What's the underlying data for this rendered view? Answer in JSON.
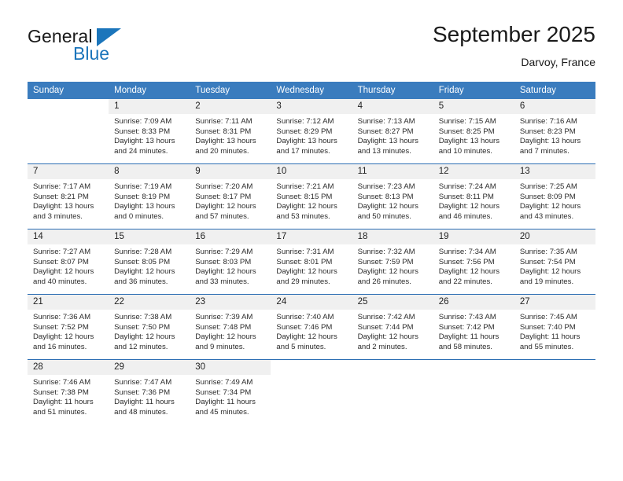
{
  "brand": {
    "name_part1": "General",
    "name_part2": "Blue",
    "flag_icon": "triangle-flag-icon",
    "accent_color": "#1b75bb"
  },
  "header": {
    "month_title": "September 2025",
    "location": "Darvoy, France"
  },
  "colors": {
    "header_blue": "#3a7cbe",
    "week_divider_blue": "#2a6db3",
    "daynum_band": "#f0f0f0",
    "text": "#2b2b2b"
  },
  "calendar": {
    "weekday_headers": [
      "Sunday",
      "Monday",
      "Tuesday",
      "Wednesday",
      "Thursday",
      "Friday",
      "Saturday"
    ],
    "weeks": [
      [
        {
          "day": "",
          "lines": []
        },
        {
          "day": "1",
          "lines": [
            "Sunrise: 7:09 AM",
            "Sunset: 8:33 PM",
            "Daylight: 13 hours",
            "and 24 minutes."
          ]
        },
        {
          "day": "2",
          "lines": [
            "Sunrise: 7:11 AM",
            "Sunset: 8:31 PM",
            "Daylight: 13 hours",
            "and 20 minutes."
          ]
        },
        {
          "day": "3",
          "lines": [
            "Sunrise: 7:12 AM",
            "Sunset: 8:29 PM",
            "Daylight: 13 hours",
            "and 17 minutes."
          ]
        },
        {
          "day": "4",
          "lines": [
            "Sunrise: 7:13 AM",
            "Sunset: 8:27 PM",
            "Daylight: 13 hours",
            "and 13 minutes."
          ]
        },
        {
          "day": "5",
          "lines": [
            "Sunrise: 7:15 AM",
            "Sunset: 8:25 PM",
            "Daylight: 13 hours",
            "and 10 minutes."
          ]
        },
        {
          "day": "6",
          "lines": [
            "Sunrise: 7:16 AM",
            "Sunset: 8:23 PM",
            "Daylight: 13 hours",
            "and 7 minutes."
          ]
        }
      ],
      [
        {
          "day": "7",
          "lines": [
            "Sunrise: 7:17 AM",
            "Sunset: 8:21 PM",
            "Daylight: 13 hours",
            "and 3 minutes."
          ]
        },
        {
          "day": "8",
          "lines": [
            "Sunrise: 7:19 AM",
            "Sunset: 8:19 PM",
            "Daylight: 13 hours",
            "and 0 minutes."
          ]
        },
        {
          "day": "9",
          "lines": [
            "Sunrise: 7:20 AM",
            "Sunset: 8:17 PM",
            "Daylight: 12 hours",
            "and 57 minutes."
          ]
        },
        {
          "day": "10",
          "lines": [
            "Sunrise: 7:21 AM",
            "Sunset: 8:15 PM",
            "Daylight: 12 hours",
            "and 53 minutes."
          ]
        },
        {
          "day": "11",
          "lines": [
            "Sunrise: 7:23 AM",
            "Sunset: 8:13 PM",
            "Daylight: 12 hours",
            "and 50 minutes."
          ]
        },
        {
          "day": "12",
          "lines": [
            "Sunrise: 7:24 AM",
            "Sunset: 8:11 PM",
            "Daylight: 12 hours",
            "and 46 minutes."
          ]
        },
        {
          "day": "13",
          "lines": [
            "Sunrise: 7:25 AM",
            "Sunset: 8:09 PM",
            "Daylight: 12 hours",
            "and 43 minutes."
          ]
        }
      ],
      [
        {
          "day": "14",
          "lines": [
            "Sunrise: 7:27 AM",
            "Sunset: 8:07 PM",
            "Daylight: 12 hours",
            "and 40 minutes."
          ]
        },
        {
          "day": "15",
          "lines": [
            "Sunrise: 7:28 AM",
            "Sunset: 8:05 PM",
            "Daylight: 12 hours",
            "and 36 minutes."
          ]
        },
        {
          "day": "16",
          "lines": [
            "Sunrise: 7:29 AM",
            "Sunset: 8:03 PM",
            "Daylight: 12 hours",
            "and 33 minutes."
          ]
        },
        {
          "day": "17",
          "lines": [
            "Sunrise: 7:31 AM",
            "Sunset: 8:01 PM",
            "Daylight: 12 hours",
            "and 29 minutes."
          ]
        },
        {
          "day": "18",
          "lines": [
            "Sunrise: 7:32 AM",
            "Sunset: 7:59 PM",
            "Daylight: 12 hours",
            "and 26 minutes."
          ]
        },
        {
          "day": "19",
          "lines": [
            "Sunrise: 7:34 AM",
            "Sunset: 7:56 PM",
            "Daylight: 12 hours",
            "and 22 minutes."
          ]
        },
        {
          "day": "20",
          "lines": [
            "Sunrise: 7:35 AM",
            "Sunset: 7:54 PM",
            "Daylight: 12 hours",
            "and 19 minutes."
          ]
        }
      ],
      [
        {
          "day": "21",
          "lines": [
            "Sunrise: 7:36 AM",
            "Sunset: 7:52 PM",
            "Daylight: 12 hours",
            "and 16 minutes."
          ]
        },
        {
          "day": "22",
          "lines": [
            "Sunrise: 7:38 AM",
            "Sunset: 7:50 PM",
            "Daylight: 12 hours",
            "and 12 minutes."
          ]
        },
        {
          "day": "23",
          "lines": [
            "Sunrise: 7:39 AM",
            "Sunset: 7:48 PM",
            "Daylight: 12 hours",
            "and 9 minutes."
          ]
        },
        {
          "day": "24",
          "lines": [
            "Sunrise: 7:40 AM",
            "Sunset: 7:46 PM",
            "Daylight: 12 hours",
            "and 5 minutes."
          ]
        },
        {
          "day": "25",
          "lines": [
            "Sunrise: 7:42 AM",
            "Sunset: 7:44 PM",
            "Daylight: 12 hours",
            "and 2 minutes."
          ]
        },
        {
          "day": "26",
          "lines": [
            "Sunrise: 7:43 AM",
            "Sunset: 7:42 PM",
            "Daylight: 11 hours",
            "and 58 minutes."
          ]
        },
        {
          "day": "27",
          "lines": [
            "Sunrise: 7:45 AM",
            "Sunset: 7:40 PM",
            "Daylight: 11 hours",
            "and 55 minutes."
          ]
        }
      ],
      [
        {
          "day": "28",
          "lines": [
            "Sunrise: 7:46 AM",
            "Sunset: 7:38 PM",
            "Daylight: 11 hours",
            "and 51 minutes."
          ]
        },
        {
          "day": "29",
          "lines": [
            "Sunrise: 7:47 AM",
            "Sunset: 7:36 PM",
            "Daylight: 11 hours",
            "and 48 minutes."
          ]
        },
        {
          "day": "30",
          "lines": [
            "Sunrise: 7:49 AM",
            "Sunset: 7:34 PM",
            "Daylight: 11 hours",
            "and 45 minutes."
          ]
        },
        {
          "day": "",
          "lines": []
        },
        {
          "day": "",
          "lines": []
        },
        {
          "day": "",
          "lines": []
        },
        {
          "day": "",
          "lines": []
        }
      ]
    ]
  }
}
